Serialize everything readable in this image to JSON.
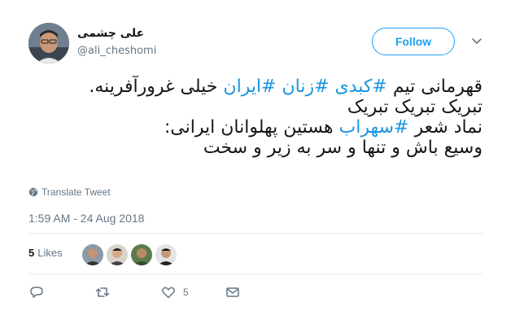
{
  "user": {
    "display_name": "علی چشمی",
    "handle": "@ali_cheshomi"
  },
  "follow_label": "Follow",
  "tweet": {
    "line1": {
      "pre": "قهرمانی تیم ",
      "tag1": "#کبدی",
      "sp1": " ",
      "tag2": "#زنان",
      "sp2": " ",
      "tag3": "#ایران",
      "post": " خیلی غرورآفرینه."
    },
    "line2": "تبریک تبریک تبریک",
    "line3": {
      "pre": "نماد شعر ",
      "tag": "#سهراب",
      "post": " هستین پهلوانان ایرانی:"
    },
    "line4": "وسیع باش و تنها و سر به زیر و سخت"
  },
  "translate_label": "Translate Tweet",
  "timestamp": "1:59 AM - 24 Aug 2018",
  "stats": {
    "likes_count": "5",
    "likes_label": "Likes"
  },
  "actions": {
    "like_count": "5"
  },
  "colors": {
    "accent": "#1da1f2",
    "hashtag": "#1b95e0",
    "muted": "#657786"
  }
}
